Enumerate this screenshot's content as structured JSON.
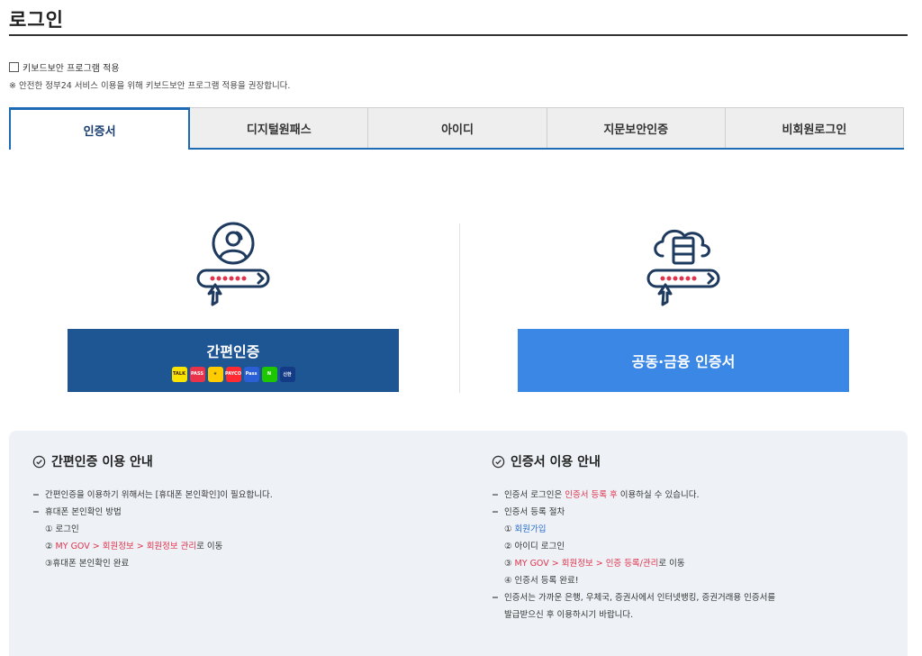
{
  "page": {
    "title": "로그인"
  },
  "keyboard": {
    "checkbox_label": "키보드보안 프로그램 적용",
    "notice": "※ 안전한 정부24 서비스 이용을 위해 키보드보안 프로그램 적용을 권장합니다."
  },
  "tabs": [
    {
      "label": "인증서",
      "active": true
    },
    {
      "label": "디지털원패스",
      "active": false
    },
    {
      "label": "아이디",
      "active": false
    },
    {
      "label": "지문보안인증",
      "active": false
    },
    {
      "label": "비회원로그인",
      "active": false
    }
  ],
  "simple_auth": {
    "button_label": "간편인증",
    "apps": [
      {
        "name": "kakao",
        "text": "TALK",
        "bg": "#fbe300",
        "fg": "#3a1d1d"
      },
      {
        "name": "pass",
        "text": "PASS",
        "bg": "#e8334a",
        "fg": "#ffffff"
      },
      {
        "name": "kb",
        "text": "★",
        "bg": "#ffcc00",
        "fg": "#5a4a2a"
      },
      {
        "name": "payco",
        "text": "PAYCO",
        "bg": "#ff2a32",
        "fg": "#ffffff"
      },
      {
        "name": "samsung-pass",
        "text": "Pass",
        "bg": "#2a5fd6",
        "fg": "#ffffff"
      },
      {
        "name": "naver",
        "text": "N",
        "bg": "#1ec800",
        "fg": "#ffffff"
      },
      {
        "name": "shinhan",
        "text": "신한",
        "bg": "#143c86",
        "fg": "#ffffff"
      }
    ]
  },
  "cert_button": {
    "label": "공동·금융 인증서"
  },
  "guide_simple": {
    "title": "간편인증 이용 안내",
    "item1": "간편인증을 이용하기 위해서는 [휴대폰 본인확인]이 필요합니다.",
    "item2": "휴대폰 본인확인 방법",
    "step1": "① 로그인",
    "step2_prefix": "② ",
    "step2_link": "MY GOV > 회원정보 > 회원정보 관리",
    "step2_suffix": "로 이동",
    "step3": "③휴대폰 본인확인 완료"
  },
  "guide_cert": {
    "title": "인증서 이용 안내",
    "item1_prefix": "인증서 로그인은 ",
    "item1_highlight": "인증서 등록 후",
    "item1_suffix": " 이용하실 수 있습니다.",
    "item2": "인증서 등록 절차",
    "step1_prefix": "① ",
    "step1_link": "회원가입",
    "step2": "② 아이디 로그인",
    "step3_prefix": "③ ",
    "step3_link": "MY GOV > 회원정보 > 인증 등록/관리",
    "step3_suffix": "로 이동",
    "step4": "④ 인증서 등록 완료!",
    "item3_line1": "인증서는 가까운 은행, 우체국, 증권사에서 인터넷뱅킹, 증권거래용 인증서를",
    "item3_line2": "발급받으신 후 이용하시기 바랍니다."
  },
  "colors": {
    "simple_button": "#1e5593",
    "cert_button": "#3a87e6",
    "tab_accent": "#1d6bb5",
    "highlight_red": "#e0334d",
    "link_blue": "#2a6dd1"
  }
}
